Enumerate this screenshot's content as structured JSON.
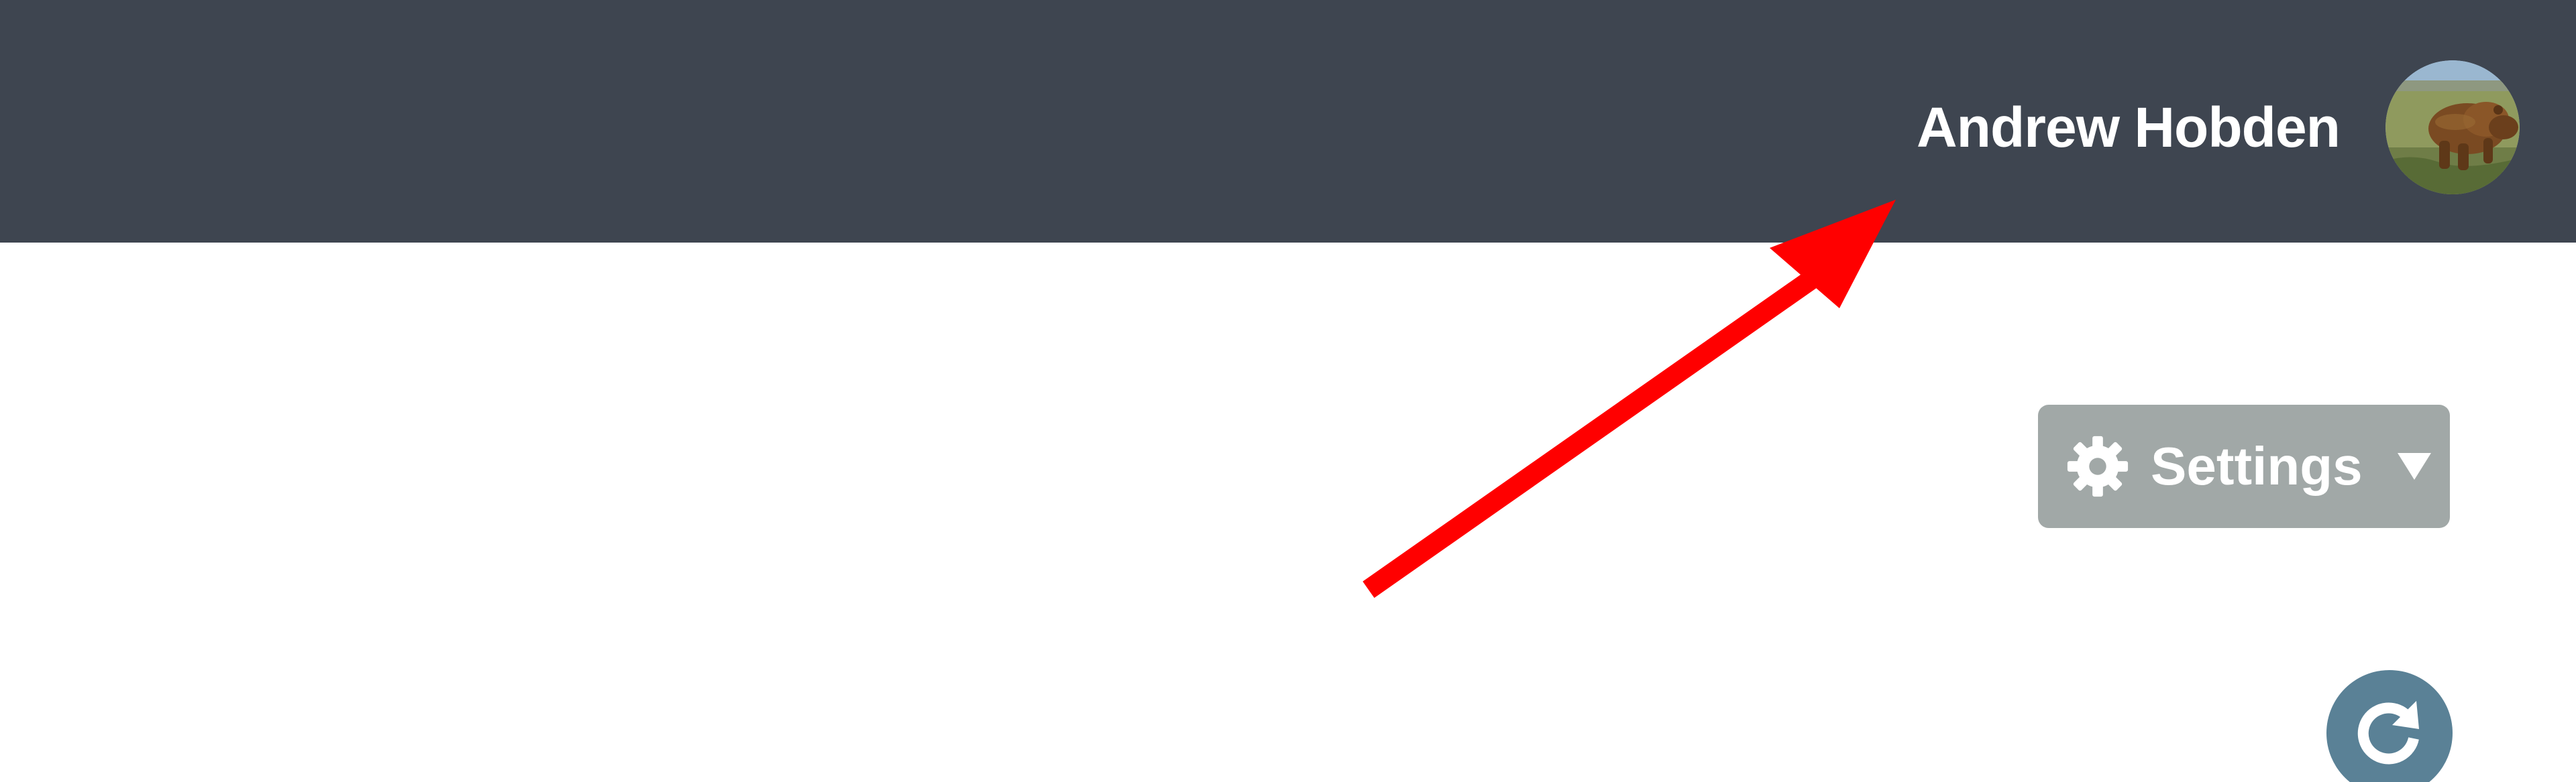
{
  "header": {
    "user_name": "Andrew Hobden",
    "avatar_icon": "bear-avatar-icon"
  },
  "toolbar": {
    "settings_label": "Settings",
    "settings_icon": "gear-icon",
    "dropdown_icon": "caret-down-icon",
    "refresh_icon": "refresh-icon"
  },
  "annotation": {
    "arrow_icon": "red-arrow-icon",
    "arrow_color": "#ff0000"
  },
  "colors": {
    "header_background": "#3e4550",
    "settings_button": "#a1a8a7",
    "refresh_button": "#5a8196"
  }
}
